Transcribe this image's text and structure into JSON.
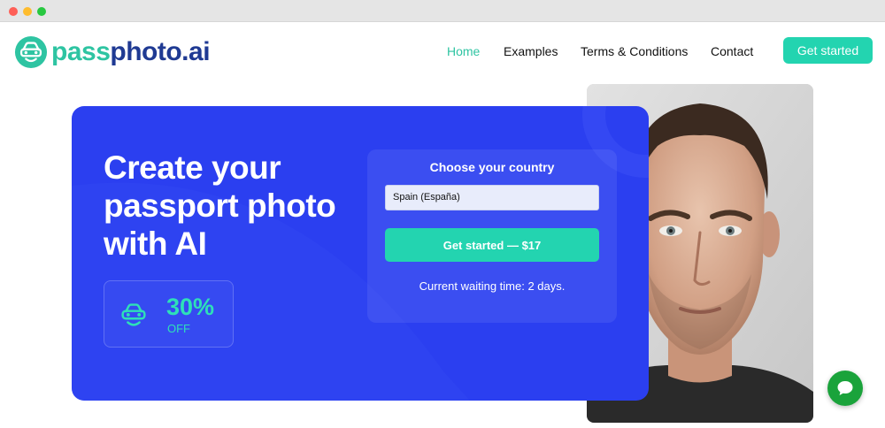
{
  "brand": {
    "part1": "pass",
    "part2": "photo.ai",
    "icon": "car-face-logo-icon",
    "colors": {
      "teal": "#2ec4a2",
      "navy": "#1f3a93"
    }
  },
  "nav": {
    "items": [
      {
        "label": "Home",
        "active": true
      },
      {
        "label": "Examples",
        "active": false
      },
      {
        "label": "Terms & Conditions",
        "active": false
      },
      {
        "label": "Contact",
        "active": false
      }
    ],
    "cta_label": "Get started"
  },
  "hero": {
    "title": "Create your passport photo with AI",
    "discount": {
      "value": "30%",
      "label": "OFF",
      "icon": "car-face-icon"
    },
    "form": {
      "heading": "Choose your country",
      "country_value": "Spain (España)",
      "cta_label": "Get started — $17",
      "waiting_text": "Current waiting time: 2 days."
    },
    "colors": {
      "background": "#2b3ff0",
      "accent": "#23d4b0"
    }
  },
  "portrait": {
    "icon": "passport-portrait-photo"
  },
  "chat": {
    "icon": "chat-bubble-icon",
    "color": "#1aa33b"
  }
}
